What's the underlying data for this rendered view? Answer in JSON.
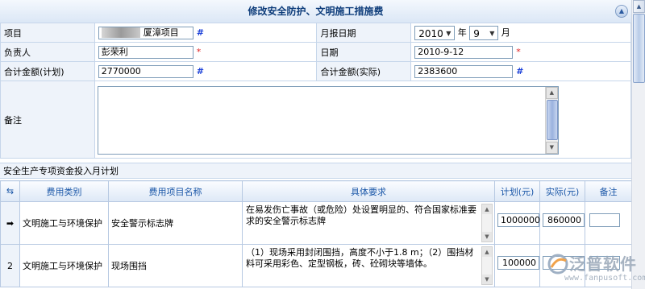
{
  "title": "修改安全防护、文明施工措施费",
  "form": {
    "project_label": "项目",
    "project_value": "厦漳项目",
    "month_label": "月报日期",
    "year_value": "2010",
    "year_unit": "年",
    "month_value": "9",
    "month_unit": "月",
    "owner_label": "负责人",
    "owner_value": "彭荣利",
    "date_label": "日期",
    "date_value": "2010-9-12",
    "plan_total_label": "合计金额(计划)",
    "plan_total_value": "2770000",
    "actual_total_label": "合计金额(实际)",
    "actual_total_value": "2383600",
    "remark_label": "备注",
    "hash_mark": "#",
    "required_mark": "*"
  },
  "section_title": "安全生产专项资金投入月计划",
  "grid": {
    "headers": [
      "费用类别",
      "费用项目名称",
      "具体要求",
      "计划(元)",
      "实际(元)",
      "备注"
    ],
    "rows": [
      {
        "marker": "➡",
        "category": "文明施工与环境保护",
        "item": "安全警示标志牌",
        "requirement": "在易发伤亡事故（或危险）处设置明显的、符合国家标准要求的安全警示标志牌",
        "plan": "1000000",
        "actual": "860000",
        "remark": ""
      },
      {
        "marker": "2",
        "category": "文明施工与环境保护",
        "item": "现场围挡",
        "requirement": "（1）现场采用封闭围挡，高度不小于1.8 m；（2）围挡材料可采用彩色、定型钢板，砖、砼砌块等墙体。",
        "plan": "100000",
        "actual": "",
        "remark": ""
      }
    ]
  },
  "logo": {
    "name": "泛普软件",
    "url": "www.fanpusoft.com"
  },
  "colors": {
    "title_text": "#0d3c7a",
    "header_text": "#1b57a8",
    "hash": "#1a3fd8",
    "required": "#e02020"
  }
}
